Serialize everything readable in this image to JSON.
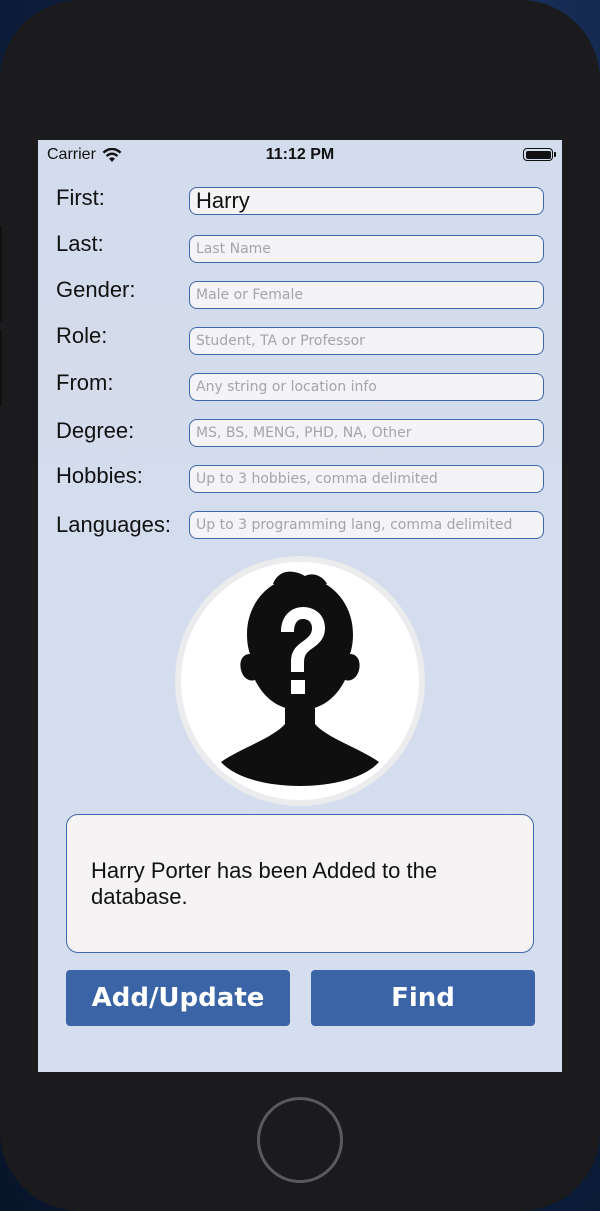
{
  "status_bar": {
    "carrier": "Carrier",
    "time": "11:12 PM",
    "icons": [
      "wifi-icon",
      "battery-icon"
    ]
  },
  "form": {
    "fields": [
      {
        "label": "First:",
        "value": "Harry",
        "placeholder": ""
      },
      {
        "label": "Last:",
        "value": "",
        "placeholder": "Last Name"
      },
      {
        "label": "Gender:",
        "value": "",
        "placeholder": "Male or Female"
      },
      {
        "label": "Role:",
        "value": "",
        "placeholder": "Student, TA or Professor"
      },
      {
        "label": "From:",
        "value": "",
        "placeholder": "Any string or location info"
      },
      {
        "label": "Degree:",
        "value": "",
        "placeholder": "MS, BS, MENG, PHD, NA, Other"
      },
      {
        "label": "Hobbies:",
        "value": "",
        "placeholder": "Up to 3 hobbies, comma delimited"
      },
      {
        "label": "Languages:",
        "value": "",
        "placeholder": "Up to 3 programming lang, comma delimited"
      }
    ]
  },
  "avatar": {
    "icon": "unknown-person-icon"
  },
  "message": {
    "text": "Harry Porter  has been Added to the database."
  },
  "buttons": {
    "add_update": "Add/Update",
    "find": "Find"
  },
  "colors": {
    "accent": "#3a64a5",
    "screen_bg": "#d3dcec",
    "input_bg": "#f4f3f5",
    "phone_body": "#1b1a1d"
  }
}
